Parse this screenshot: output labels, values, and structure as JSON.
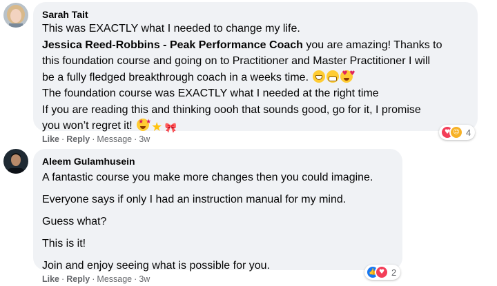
{
  "comments": [
    {
      "author": "Sarah Tait",
      "lines": [
        {
          "text": "This was EXACTLY what I needed to change my life."
        },
        {
          "mention": "Jessica Reed-Robbins - Peak Performance Coach",
          "text": " you are amazing! Thanks to"
        },
        {
          "text": "this foundation course and going on to Practitioner and Master Practitioner I will"
        },
        {
          "text": "be a fully fledged breakthrough coach in a weeks time."
        },
        {
          "text": "The foundation course was EXACTLY what I needed at the right time"
        },
        {
          "text": "If you are reading this and thinking oooh that sounds good, go for it, I promise"
        },
        {
          "text": "you won’t regret it!"
        }
      ],
      "emojis_line4": [
        "grinning-face-emoji",
        "grimacing-face-emoji",
        "heart-eyes-emoji"
      ],
      "emojis_line7": [
        "star-struck-emoji",
        "star-emoji",
        "ribbon-emoji"
      ],
      "reaction_count": "4",
      "reaction_icons": [
        "love-reaction-icon",
        "care-reaction-icon"
      ],
      "actions": {
        "like": "Like",
        "reply": "Reply",
        "message": "Message",
        "time": "3w"
      }
    },
    {
      "author": "Aleem Gulamhusein",
      "lines": [
        {
          "text": "A fantastic course you make more changes then you could imagine."
        },
        {
          "text": "Everyone says if only I had an instruction manual for my mind."
        },
        {
          "text": "Guess what?"
        },
        {
          "text": "This is it!"
        },
        {
          "text": "Join and enjoy seeing what is possible for you."
        }
      ],
      "reaction_count": "2",
      "reaction_icons": [
        "like-reaction-icon",
        "love-reaction-icon"
      ],
      "actions": {
        "like": "Like",
        "reply": "Reply",
        "message": "Message",
        "time": "3w"
      }
    }
  ],
  "separator": "·",
  "colors": {
    "bubble": "#f0f2f5",
    "meta_text": "#65676b",
    "like_blue": "#1877f2",
    "love_red": "#f33e58",
    "care_yellow": "#f7b125"
  }
}
